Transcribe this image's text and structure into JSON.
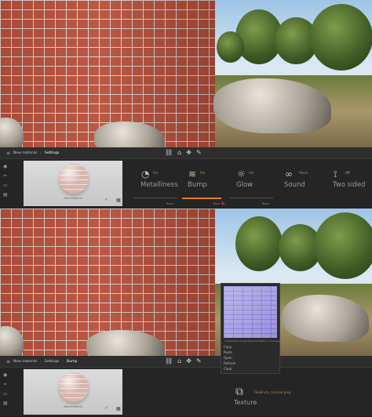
{
  "top": {
    "breadcrumb": [
      "New material",
      "Settings"
    ],
    "preview_label": "New material",
    "properties": [
      {
        "name": "metalliness",
        "label": "Metalliness",
        "value": "0%",
        "icon": "gauge-icon"
      },
      {
        "name": "bump",
        "label": "Bump",
        "value": "0%",
        "icon": "waves-icon"
      },
      {
        "name": "glow",
        "label": "Glow",
        "value": "0%",
        "icon": "sun-icon"
      },
      {
        "name": "sound",
        "label": "Sound",
        "value": "Wood",
        "icon": "footsteps-icon"
      },
      {
        "name": "two-sided",
        "label": "Two sided",
        "value": "Off",
        "icon": "two-sided-icon"
      }
    ],
    "sliders": [
      {
        "label": "Base",
        "level": 0.0
      },
      {
        "label": "Base",
        "level": 0.9
      },
      {
        "label": "Base",
        "level": 0.0
      }
    ]
  },
  "bottom": {
    "breadcrumb": [
      "New material",
      "Settings",
      "Bump"
    ],
    "preview_label": "New material",
    "popup": {
      "path": "C:/Users/Documents/Textures/TileBrick_normal.png",
      "menu": [
        "Copy",
        "Paste",
        "Open",
        "Refresh",
        "Clear"
      ]
    },
    "texture": {
      "label": "Texture",
      "filename": "TileBrick_normal.png"
    }
  },
  "colors": {
    "accent": "#e07b24",
    "panel": "#252525",
    "bar": "#2d2d2d"
  }
}
